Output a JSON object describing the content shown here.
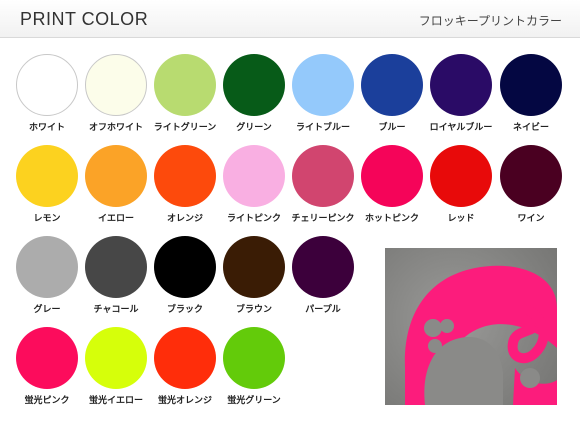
{
  "header": {
    "title": "PRINT COLOR",
    "subtitle": "フロッキープリントカラー"
  },
  "swatches": [
    {
      "label": "ホワイト",
      "color": "#ffffff",
      "outlined": true
    },
    {
      "label": "オフホワイト",
      "color": "#fcfdea",
      "outlined": true
    },
    {
      "label": "ライトグリーン",
      "color": "#b8db70",
      "outlined": false
    },
    {
      "label": "グリーン",
      "color": "#075b18",
      "outlined": false
    },
    {
      "label": "ライトブルー",
      "color": "#94c9fb",
      "outlined": false
    },
    {
      "label": "ブルー",
      "color": "#1b3f9b",
      "outlined": false
    },
    {
      "label": "ロイヤルブルー",
      "color": "#2a0b66",
      "outlined": false
    },
    {
      "label": "ネイビー",
      "color": "#040742",
      "outlined": false
    },
    {
      "label": "レモン",
      "color": "#fcd21f",
      "outlined": false
    },
    {
      "label": "イエロー",
      "color": "#fba327",
      "outlined": false
    },
    {
      "label": "オレンジ",
      "color": "#fd4a0c",
      "outlined": false
    },
    {
      "label": "ライトピンク",
      "color": "#f9afe2",
      "outlined": false
    },
    {
      "label": "チェリーピンク",
      "color": "#d1456f",
      "outlined": false
    },
    {
      "label": "ホットピンク",
      "color": "#f50459",
      "outlined": false
    },
    {
      "label": "レッド",
      "color": "#e80a0a",
      "outlined": false
    },
    {
      "label": "ワイン",
      "color": "#4a0021",
      "outlined": false
    },
    {
      "label": "グレー",
      "color": "#acacac",
      "outlined": false
    },
    {
      "label": "チャコール",
      "color": "#474747",
      "outlined": false
    },
    {
      "label": "ブラック",
      "color": "#000000",
      "outlined": false
    },
    {
      "label": "ブラウン",
      "color": "#3a1c05",
      "outlined": false
    },
    {
      "label": "パープル",
      "color": "#3c003b",
      "outlined": false
    },
    {
      "label": "蛍光ピンク",
      "color": "#fc0c5c",
      "outlined": false
    },
    {
      "label": "蛍光イエロー",
      "color": "#d6ff0a",
      "outlined": false
    },
    {
      "label": "蛍光オレンジ",
      "color": "#ff2d0a",
      "outlined": false
    },
    {
      "label": "蛍光グリーン",
      "color": "#63cb0a",
      "outlined": false
    }
  ],
  "sample_photo": {
    "fabric_color": "#8a8a88",
    "print_color": "#fc1c7c"
  }
}
